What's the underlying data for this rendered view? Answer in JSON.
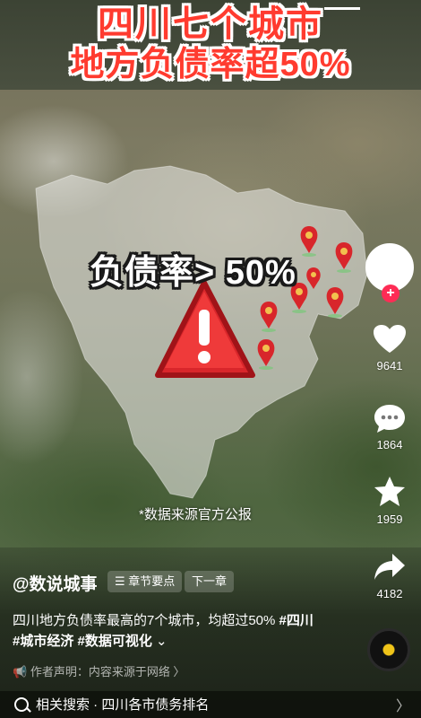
{
  "overlay": {
    "title_line1": "四川七个城市",
    "title_line2": "地方负债率超50%",
    "ratio_label": "负债率> 50%",
    "source_note": "*数据来源官方公报"
  },
  "sidebar": {
    "likes": "9641",
    "comments": "1864",
    "favorites": "1959",
    "shares": "4182",
    "follow_symbol": "+"
  },
  "post": {
    "author": "@数说城事",
    "chapters_label": "章节要点",
    "next_chapter_label": "下一章",
    "description_text": "四川地方负债率最高的7个城市，均超过50%",
    "hashtags": [
      "#四川",
      "#城市经济",
      "#数据可视化"
    ],
    "expand_symbol": "⌄",
    "author_statement": "作者声明：内容来源于网络 〉"
  },
  "related_search": {
    "label": "相关搜索 · 四川各市债务排名",
    "arrow": "〉"
  },
  "colors": {
    "title_red": "#ff3b2f",
    "follow_red": "#fe2c55",
    "pin_red": "#d8262b"
  }
}
